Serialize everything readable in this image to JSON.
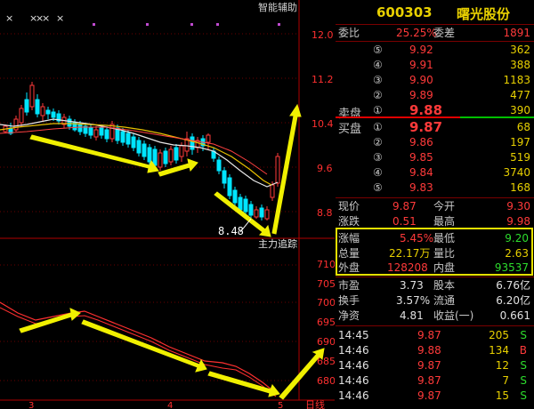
{
  "chart": {
    "smart_assist_label": "智能辅助",
    "price_axis": [
      "12.0",
      "11.2",
      "10.4",
      "9.6",
      "8.8"
    ],
    "low_price_marker": "8.48",
    "indicator_title": "主力追踪",
    "indicator_axis": [
      "710",
      "705",
      "700",
      "695",
      "690",
      "685",
      "680"
    ],
    "x_ticks": [
      "3",
      "4",
      "5"
    ],
    "period_tab": "日线",
    "marker_symbols": [
      "×",
      "×",
      "×",
      "×",
      "×"
    ]
  },
  "quote": {
    "code": "600303",
    "name": "曙光股份",
    "weibi_label": "委比",
    "weibi_value": "25.25%",
    "weicha_label": "委差",
    "weicha_value": "1891",
    "sell_label": "卖盘",
    "buy_label": "买盘",
    "sell": [
      {
        "num": "⑤",
        "price": "9.92",
        "vol": "362"
      },
      {
        "num": "④",
        "price": "9.91",
        "vol": "388"
      },
      {
        "num": "③",
        "price": "9.90",
        "vol": "1183"
      },
      {
        "num": "②",
        "price": "9.89",
        "vol": "477"
      },
      {
        "num": "①",
        "price": "9.88",
        "vol": "390"
      }
    ],
    "buy": [
      {
        "num": "①",
        "price": "9.87",
        "vol": "68"
      },
      {
        "num": "②",
        "price": "9.86",
        "vol": "197"
      },
      {
        "num": "③",
        "price": "9.85",
        "vol": "519"
      },
      {
        "num": "④",
        "price": "9.84",
        "vol": "3740"
      },
      {
        "num": "⑤",
        "price": "9.83",
        "vol": "168"
      }
    ],
    "stats": {
      "xianjia_label": "现价",
      "xianjia": "9.87",
      "jinkai_label": "今开",
      "jinkai": "9.30",
      "zhangdie_label": "涨跌",
      "zhangdie": "0.51",
      "zuigao_label": "最高",
      "zuigao": "9.98",
      "zhangfu_label": "涨幅",
      "zhangfu": "5.45%",
      "zuidi_label": "最低",
      "zuidi": "9.20",
      "zongliang_label": "总量",
      "zongliang": "22.17万",
      "liangbi_label": "量比",
      "liangbi": "2.63",
      "waipan_label": "外盘",
      "waipan": "128208",
      "neipan_label": "内盘",
      "neipan": "93537",
      "shiying_label": "市盈",
      "shiying": "3.73",
      "guben_label": "股本",
      "guben": "6.76亿",
      "huanshou_label": "换手",
      "huanshou": "3.57%",
      "liutong_label": "流通",
      "liutong": "6.20亿",
      "jingzi_label": "净资",
      "jingzi": "4.81",
      "shouyi_label": "收益(一)",
      "shouyi": "0.661"
    },
    "ticks": [
      {
        "time": "14:45",
        "price": "9.87",
        "vol": "205",
        "flag": "S"
      },
      {
        "time": "14:46",
        "price": "9.88",
        "vol": "134",
        "flag": "B"
      },
      {
        "time": "14:46",
        "price": "9.87",
        "vol": "12",
        "flag": "S"
      },
      {
        "time": "14:46",
        "price": "9.87",
        "vol": "7",
        "flag": "S"
      },
      {
        "time": "14:46",
        "price": "9.87",
        "vol": "15",
        "flag": "S"
      }
    ]
  },
  "colors": {
    "up": "#ff3a3a",
    "down": "#2ddc2d",
    "accent": "#e8e000",
    "candle_down": "#00e5ff"
  }
}
